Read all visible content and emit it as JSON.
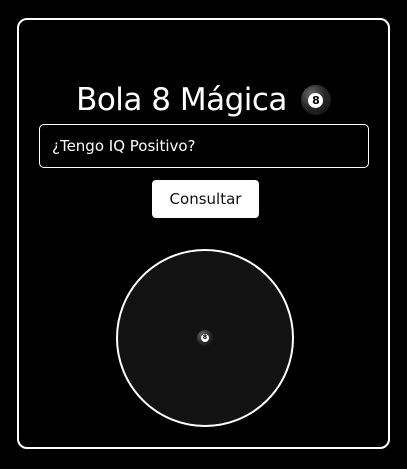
{
  "header": {
    "title": "Bola 8 Mágica",
    "icon": "8-ball-icon",
    "ball_number": "8"
  },
  "question": {
    "value": "¿Tengo IQ Positivo?"
  },
  "actions": {
    "consult_label": "Consultar"
  },
  "answer": {
    "icon": "8-ball-icon",
    "ball_number": "8"
  },
  "colors": {
    "background": "#000000",
    "foreground": "#ffffff",
    "ball_fill": "#121212"
  }
}
